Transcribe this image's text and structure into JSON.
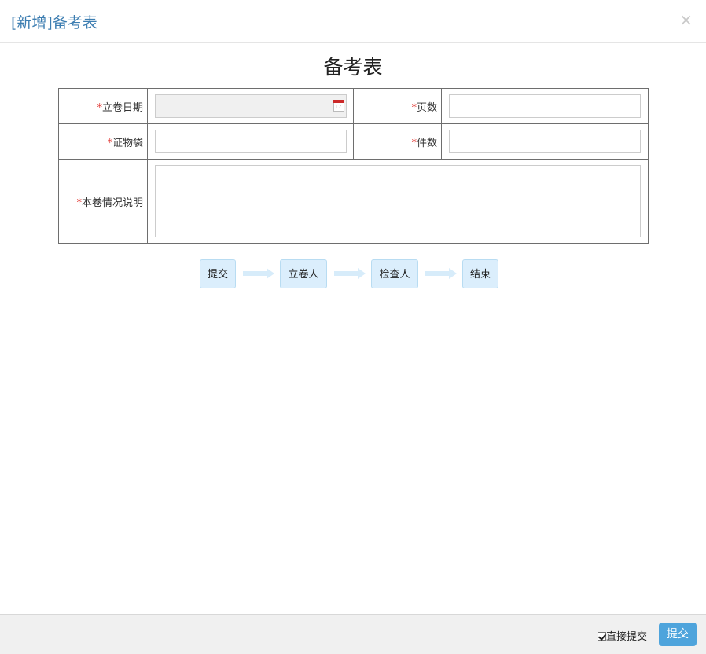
{
  "modal": {
    "title": "[新增]备考表",
    "close_label": "×"
  },
  "form": {
    "title": "备考表",
    "required_mark": "*",
    "fields": {
      "file_date": {
        "label": "立卷日期",
        "value": ""
      },
      "pages": {
        "label": "页数",
        "value": ""
      },
      "evidence_bag": {
        "label": "证物袋",
        "value": ""
      },
      "items": {
        "label": "件数",
        "value": ""
      },
      "description": {
        "label": "本卷情况说明",
        "value": ""
      }
    },
    "calendar_day": "17"
  },
  "workflow": {
    "steps": [
      "提交",
      "立卷人",
      "检查人",
      "结束"
    ]
  },
  "footer": {
    "direct_submit_label": "直接提交",
    "direct_submit_checked": true,
    "submit_label": "提交"
  },
  "colors": {
    "accent": "#4ea4dc",
    "title": "#3c7db1",
    "required": "#e0312c",
    "step_bg": "#dbeefc"
  },
  "icons": {
    "close": "close-icon",
    "calendar": "calendar-icon",
    "arrow": "arrow-right-icon"
  }
}
